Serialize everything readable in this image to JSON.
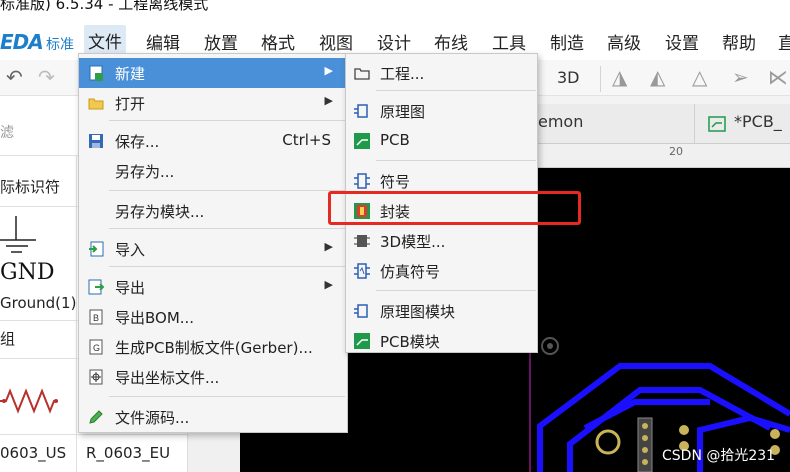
{
  "window": {
    "title": "标准版) 6.5.34 - 工程离线模式"
  },
  "app": {
    "logo": "EDA",
    "logo_sub": "标准"
  },
  "menubar": {
    "items": [
      "文件",
      "编辑",
      "放置",
      "格式",
      "视图",
      "设计",
      "布线",
      "工具",
      "制造",
      "高级",
      "设置",
      "帮助",
      "直"
    ]
  },
  "toolbar": {
    "label_3d": "3D"
  },
  "left_panel": {
    "filter_placeholder": "滤",
    "section_title": "际标识符",
    "gnd_label": "GND",
    "ground_label": "Ground(1)",
    "group_label": "组",
    "cell_left": "0603_US",
    "cell_right": "R_0603_EU"
  },
  "tabs": {
    "tab1": "emon",
    "tab2": "*PCB_"
  },
  "ruler": {
    "mark": "20"
  },
  "file_menu": {
    "items": [
      {
        "label": "新建",
        "shortcut": "",
        "submenu": true,
        "icon": "new-file-icon"
      },
      {
        "label": "打开",
        "shortcut": "",
        "submenu": true,
        "icon": "folder-open-icon"
      },
      {
        "label": "保存...",
        "shortcut": "Ctrl+S",
        "submenu": false,
        "icon": "save-icon"
      },
      {
        "label": "另存为...",
        "shortcut": "",
        "submenu": false,
        "icon": ""
      },
      {
        "label": "另存为模块...",
        "shortcut": "",
        "submenu": false,
        "icon": ""
      },
      {
        "label": "导入",
        "shortcut": "",
        "submenu": true,
        "icon": "import-icon"
      },
      {
        "label": "导出",
        "shortcut": "",
        "submenu": true,
        "icon": "export-icon"
      },
      {
        "label": "导出BOM...",
        "shortcut": "",
        "submenu": false,
        "icon": "bom-icon"
      },
      {
        "label": "生成PCB制板文件(Gerber)...",
        "shortcut": "",
        "submenu": false,
        "icon": "gerber-icon"
      },
      {
        "label": "导出坐标文件...",
        "shortcut": "",
        "submenu": false,
        "icon": "coordinate-icon"
      },
      {
        "label": "文件源码...",
        "shortcut": "",
        "submenu": false,
        "icon": "source-code-icon"
      }
    ]
  },
  "new_submenu": {
    "items": [
      {
        "label": "工程...",
        "icon": "project-icon"
      },
      {
        "label": "原理图",
        "icon": "schematic-icon"
      },
      {
        "label": "PCB",
        "icon": "pcb-icon"
      },
      {
        "label": "符号",
        "icon": "symbol-icon"
      },
      {
        "label": "封装",
        "icon": "footprint-icon"
      },
      {
        "label": "3D模型...",
        "icon": "3d-model-icon"
      },
      {
        "label": "仿真符号",
        "icon": "sim-symbol-icon"
      },
      {
        "label": "原理图模块",
        "icon": "schematic-module-icon"
      },
      {
        "label": "PCB模块",
        "icon": "pcb-module-icon"
      }
    ]
  },
  "watermark": "CSDN @拾光231",
  "colors": {
    "accent": "#4a90d9",
    "highlight": "#e52a22",
    "pcb_track": "#1a10ff",
    "logo": "#1d7ec9"
  }
}
